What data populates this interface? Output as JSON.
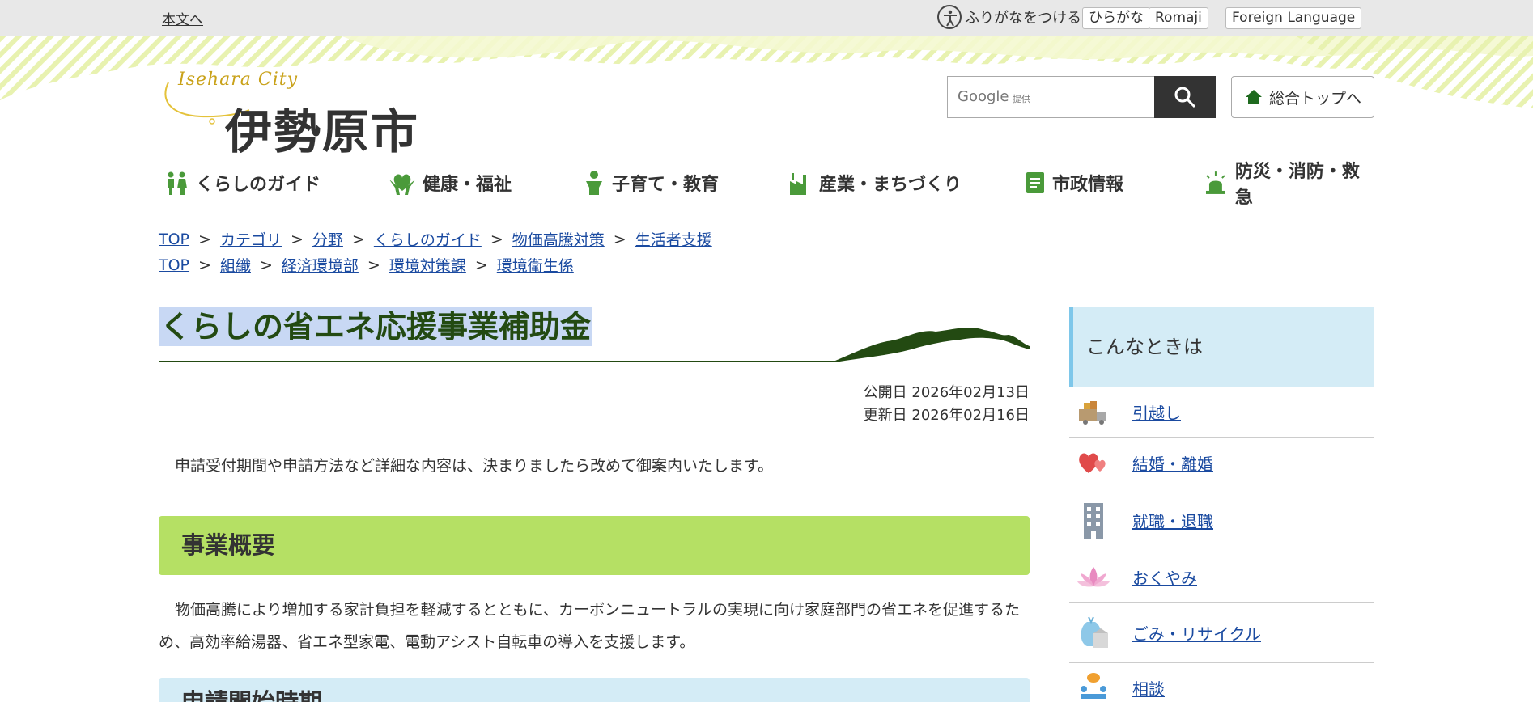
{
  "topbar": {
    "skip_link": "本文へ",
    "furigana": "ふりがなをつける",
    "hiragana": "ひらがな",
    "romaji": "Romaji",
    "foreign": "Foreign Language"
  },
  "logo": {
    "script": "Isehara City",
    "name": "伊勢原市"
  },
  "search": {
    "google_label": "Google",
    "google_sub": "提供"
  },
  "home_button": "総合トップへ",
  "nav": [
    {
      "label": "くらしのガイド",
      "icon": "people-icon"
    },
    {
      "label": "健康・福祉",
      "icon": "heart-hands-icon"
    },
    {
      "label": "子育て・教育",
      "icon": "child-icon"
    },
    {
      "label": "産業・まちづくり",
      "icon": "factory-icon"
    },
    {
      "label": "市政情報",
      "icon": "document-icon"
    },
    {
      "label": "防災・消防・救急",
      "icon": "siren-icon"
    }
  ],
  "breadcrumbs": [
    [
      "TOP",
      "カテゴリ",
      "分野",
      "くらしのガイド",
      "物価高騰対策",
      "生活者支援"
    ],
    [
      "TOP",
      "組織",
      "経済環境部",
      "環境対策課",
      "環境衛生係"
    ]
  ],
  "breadcrumb_separator": ">",
  "page": {
    "title": "くらしの省エネ応援事業補助金",
    "published": "公開日 2026年02月13日",
    "updated": "更新日 2026年02月16日",
    "intro": "申請受付期間や申請方法など詳細な内容は、決まりましたら改めて御案内いたします。",
    "section1_heading": "事業概要",
    "section1_body": "物価高騰により増加する家計負担を軽減するとともに、カーボンニュートラルの実現に向け家庭部門の省エネを促進するため、高効率給湯器、省エネ型家電、電動アシスト自転車の導入を支援します。",
    "section2_heading": "申請開始時期"
  },
  "side": {
    "heading": "こんなときは",
    "items": [
      {
        "label": "引越し",
        "icon": "moving-truck-icon"
      },
      {
        "label": "結婚・離婚",
        "icon": "hearts-icon"
      },
      {
        "label": "就職・退職",
        "icon": "building-icon"
      },
      {
        "label": "おくやみ",
        "icon": "lotus-icon"
      },
      {
        "label": "ごみ・リサイクル",
        "icon": "garbage-bag-icon"
      },
      {
        "label": "相談",
        "icon": "consultation-icon"
      }
    ]
  },
  "colors": {
    "accent_green": "#b5e064",
    "title_green": "#234a12",
    "side_blue": "#d4ecf6",
    "link_blue": "#1a4aa0"
  }
}
